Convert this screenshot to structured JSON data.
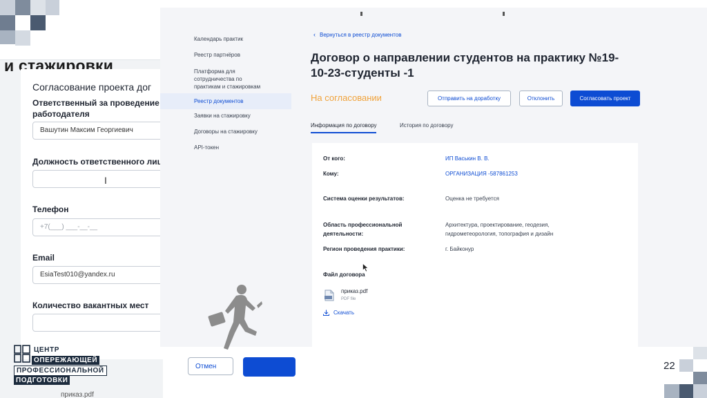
{
  "background_form": {
    "heading": "и стажировки",
    "card_title": "Согласование проекта дог",
    "fields": [
      {
        "label_line1": "Ответственный за проведение пр",
        "label_line2": "работодателя",
        "value": "Вашутин Максим Георгиевич"
      },
      {
        "label": "Должность ответственного лица",
        "value": ""
      },
      {
        "label": "Телефон",
        "placeholder": "+7(___) ___-__-__"
      },
      {
        "label": "Email",
        "value": "EsiaTest010@yandex.ru"
      },
      {
        "label": "Количество вакантных мест",
        "value": ""
      }
    ],
    "cancel_label": "Отмен",
    "bottom_file": "приказ.pdf"
  },
  "sidebar": {
    "items": [
      {
        "label": "Календарь практик"
      },
      {
        "label": "Реестр партнёров"
      },
      {
        "label_lines": [
          "Платформа для",
          "сотрудничества по",
          "практикам и стажировкам"
        ]
      },
      {
        "label": "Реестр документов",
        "active": true
      },
      {
        "label": "Заявки на стажировку"
      },
      {
        "label": "Договоры на стажировку"
      },
      {
        "label": "API-токен"
      }
    ]
  },
  "document": {
    "back_link": "Вернуться в реестр документов",
    "title_line1": "Договор о направлении студентов на практику №19-",
    "title_line2": "10-23-студенты -1",
    "status": "На согласовании",
    "status_color": "#f0a23a",
    "accent_color": "#0d4cd3",
    "actions": {
      "return_label": "Отправить на доработку",
      "reject_label": "Отклонить",
      "approve_label": "Согласовать проект"
    },
    "tabs": [
      {
        "label": "Информация по договору",
        "active": true
      },
      {
        "label": "История по договору",
        "active": false
      }
    ],
    "info": {
      "from_label": "От кого:",
      "from_value": "ИП Васькин В. В.",
      "to_label": "Кому:",
      "to_value": "ОРГАНИЗАЦИЯ -587861253",
      "eval_label": "Система оценки результатов:",
      "eval_value": "Оценка не требуется",
      "area_label_line1": "Область профессиональной",
      "area_label_line2": "деятельности:",
      "area_value_line1": "Архитектура, проектирование, геодезия,",
      "area_value_line2": "гидрометеорология, топография и дизайн",
      "region_label": "Регион проведения практики:",
      "region_value": "г. Байконур"
    },
    "file": {
      "heading": "Файл договора",
      "name": "приказ.pdf",
      "type": "PDF file",
      "download_label": "Скачать"
    }
  },
  "logo": {
    "line1": "ЦЕНТР",
    "line2": "ОПЕРЕЖАЮЩЕЙ",
    "line3": "ПРОФЕССИОНАЛЬНОЙ",
    "line4": "ПОДГОТОВКИ"
  },
  "page_number": "22"
}
